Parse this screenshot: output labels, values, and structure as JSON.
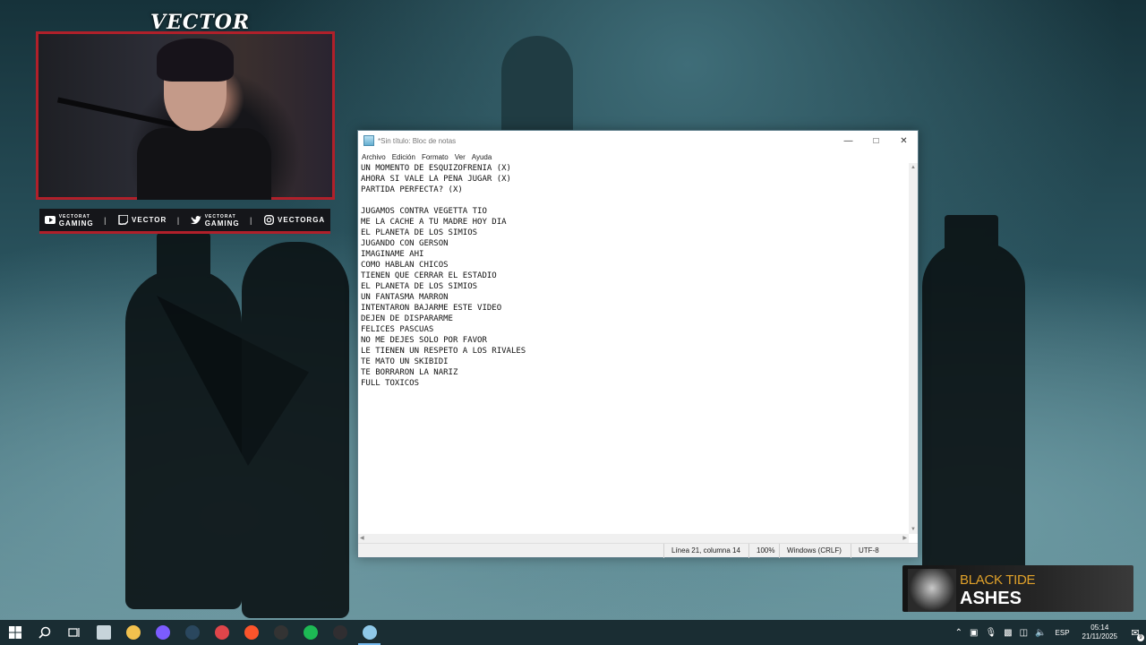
{
  "streamer": {
    "name": "VECTOR",
    "socials": [
      {
        "icon": "youtube-icon",
        "line1": "VECTORAT",
        "line2": "GAMING"
      },
      {
        "icon": "twitch-icon",
        "line1": "VECTOR",
        "line2": ""
      },
      {
        "icon": "twitter-icon",
        "line1": "VECTORAT",
        "line2": "GAMING"
      },
      {
        "icon": "instagram-icon",
        "line1": "VECTORGA",
        "line2": ""
      }
    ],
    "accent_color": "#b0202a"
  },
  "notepad": {
    "title": "*Sin título: Bloc de notas",
    "menu": [
      "Archivo",
      "Edición",
      "Formato",
      "Ver",
      "Ayuda"
    ],
    "lines": [
      "UN MOMENTO DE ESQUIZOFRENIA (X)",
      "AHORA SI VALE LA PENA JUGAR (X)",
      "PARTIDA PERFECTA? (X)",
      "",
      "JUGAMOS CONTRA VEGETTA TIO",
      "ME LA CACHE A TU MADRE HOY DIA",
      "EL PLANETA DE LOS SIMIOS",
      "JUGANDO CON GERSON",
      "IMAGINAME AHI",
      "COMO HABLAN CHICOS",
      "TIENEN QUE CERRAR EL ESTADIO",
      "EL PLANETA DE LOS SIMIOS",
      "UN FANTASMA MARRON",
      "INTENTARON BAJARME ESTE VIDEO",
      "DEJEN DE DISPARARME",
      "FELICES PASCUAS",
      "NO ME DEJES SOLO POR FAVOR",
      "LE TIENEN UN RESPETO A LOS RIVALES",
      "TE MATO UN SKIBIDI",
      "TE BORRARON LA NARIZ",
      "FULL TOXICOS"
    ],
    "status": {
      "position": "Línea 21, columna 14",
      "zoom": "100%",
      "line_endings": "Windows (CRLF)",
      "encoding": "UTF-8"
    }
  },
  "now_playing": {
    "artist": "BLACK TIDE",
    "track": "ASHES",
    "artist_color": "#e0a12a"
  },
  "taskbar": {
    "apps": [
      {
        "icon": "file-explorer-icon",
        "color": "#f2c14e"
      },
      {
        "icon": "discord-icon",
        "color": "#7c5cff"
      },
      {
        "icon": "steam-icon",
        "color": "#2a475e"
      },
      {
        "icon": "valorant-icon",
        "color": "#e0454a"
      },
      {
        "icon": "brave-icon",
        "color": "#fb542b"
      },
      {
        "icon": "epic-icon",
        "color": "#333333"
      },
      {
        "icon": "spotify-icon",
        "color": "#1db954"
      },
      {
        "icon": "obs-icon",
        "color": "#302e31"
      },
      {
        "icon": "notepad-icon",
        "color": "#8fc8e8"
      }
    ],
    "language": "ESP",
    "time": "05:14",
    "date": "21/11/2025",
    "notifications": "9"
  }
}
